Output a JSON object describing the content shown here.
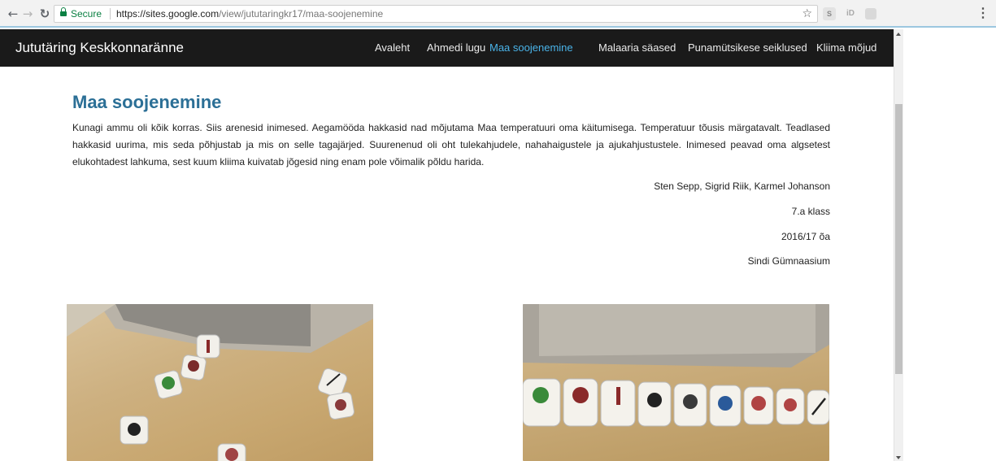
{
  "browser": {
    "secure_label": "Secure",
    "url_host": "https://sites.google.com",
    "url_path": "/view/jututaringkr17/maa-soojenemine",
    "ext2_label": "iD"
  },
  "site": {
    "title": "Jututäring Keskkonnaränne",
    "nav": [
      {
        "label": "Avaleht",
        "active": false
      },
      {
        "label": "Ahmedi lugu",
        "active": false
      },
      {
        "label": "Maa soojenemine",
        "active": true
      },
      {
        "label": "Malaaria säased",
        "active": false
      },
      {
        "label": "Punamütsikese seiklused",
        "active": false
      },
      {
        "label": "Kliima mõjud",
        "active": false
      }
    ],
    "active_color": "#4ab3e8",
    "header_bg": "#1a1a1a"
  },
  "page": {
    "title": "Maa soojenemine",
    "body": "Kunagi ammu oli kõik korras. Siis arenesid inimesed. Aegamööda hakkasid nad mõjutama Maa temperatuuri oma käitumisega. Temperatuur tõusis märgatavalt. Teadlased hakkasid uurima, mis seda põhjustab ja mis on selle tagajärjed. Suurenenud oli oht tulekahjudele, nahahaigustele ja ajukahjustustele. Inimesed peavad oma algsetest elukohtadest lahkuma, sest kuum kliima kuivatab jõgesid ning enam pole võimalik põldu harida.",
    "authors": "Sten Sepp, Sigrid Riik, Karmel Johanson",
    "class": "7.a klass",
    "year": "2016/17 õa",
    "school": "Sindi Gümnaasium",
    "title_color": "#2b6f96"
  },
  "photos": [
    {
      "icon": "story-dice-photo"
    },
    {
      "icon": "story-dice-row-photo"
    }
  ]
}
